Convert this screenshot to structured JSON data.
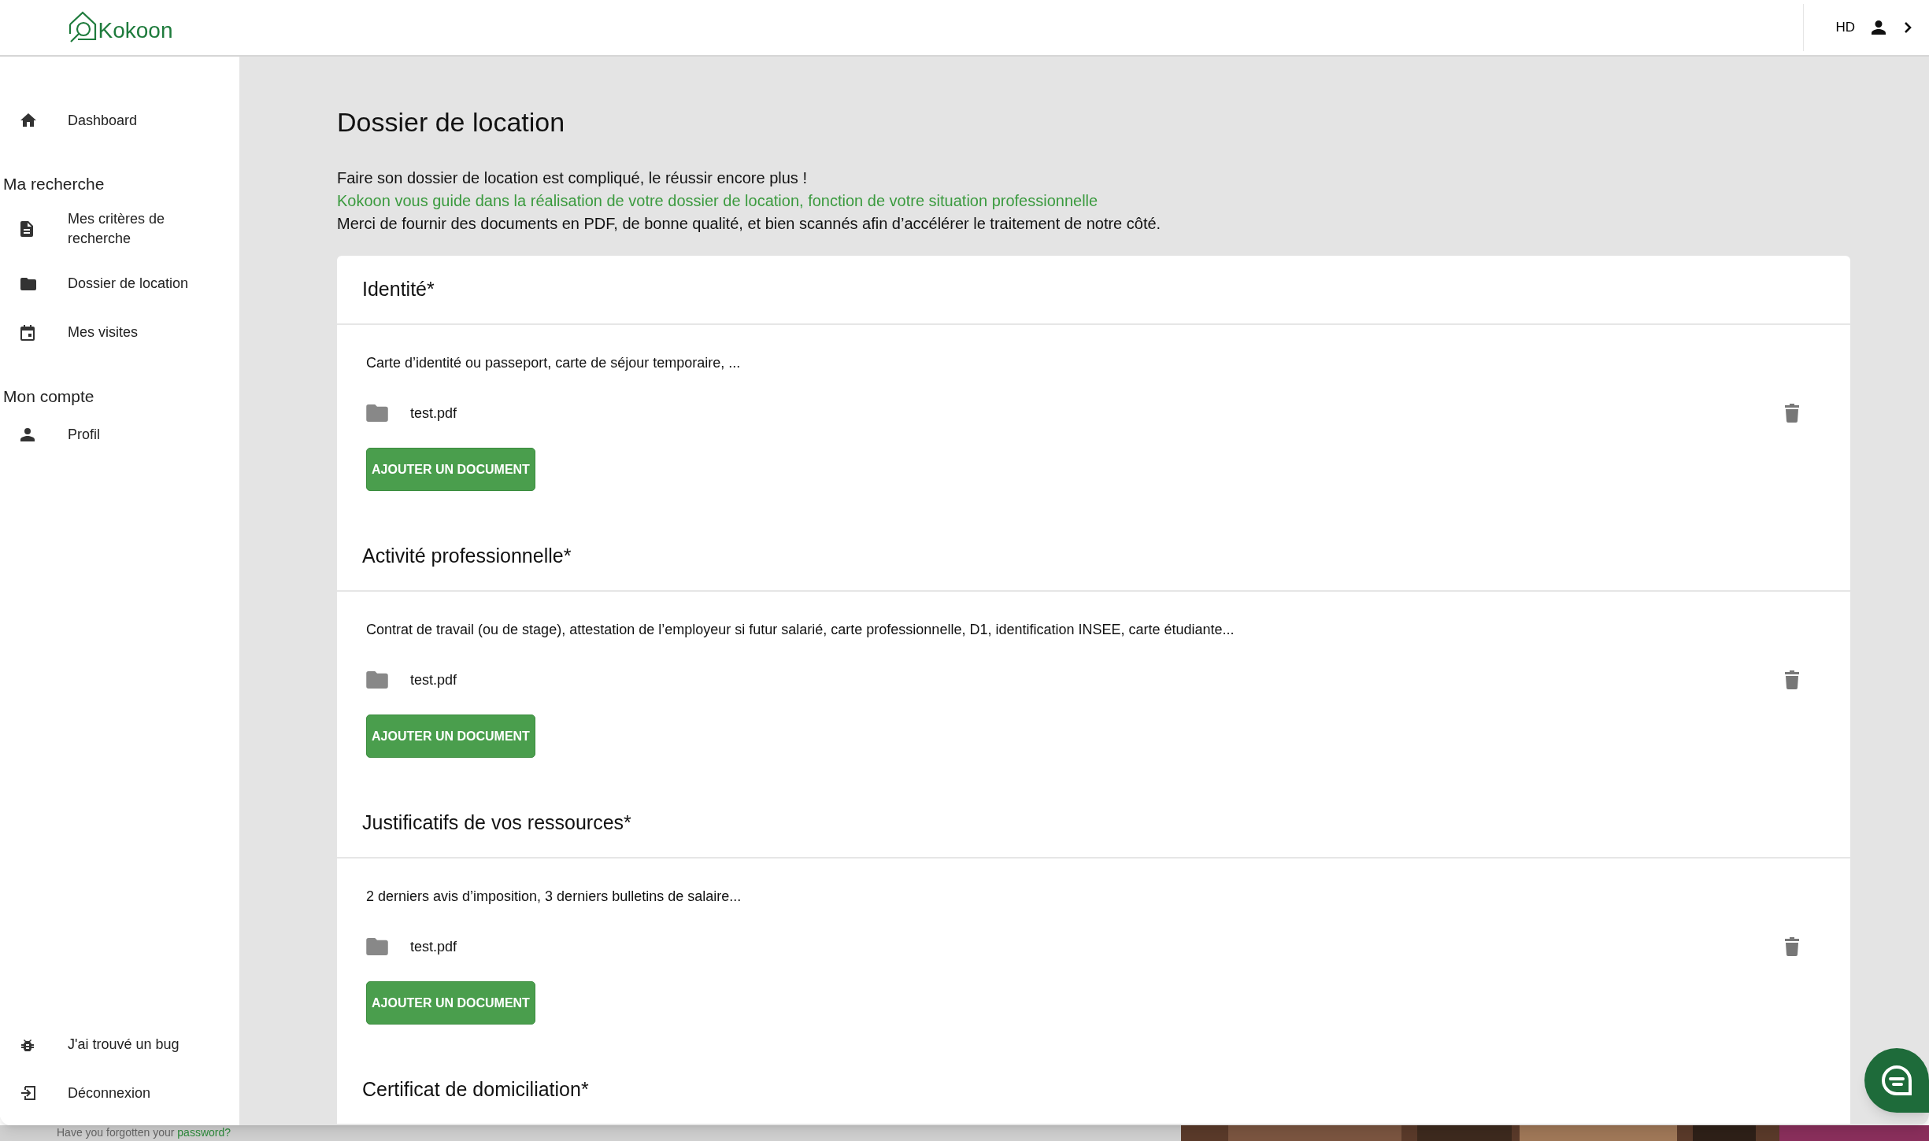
{
  "header": {
    "logo": "Kokoon",
    "user_initials": "HD"
  },
  "sidebar": {
    "top_items": [
      {
        "label": "Dashboard"
      }
    ],
    "sections": [
      {
        "heading": "Ma recherche",
        "items": [
          {
            "label": "Mes critères de recherche"
          },
          {
            "label": "Dossier de location"
          },
          {
            "label": "Mes visites"
          }
        ]
      },
      {
        "heading": "Mon compte",
        "items": [
          {
            "label": "Profil"
          }
        ]
      }
    ],
    "bottom_items": [
      {
        "label": "J'ai trouvé un bug"
      },
      {
        "label": "Déconnexion"
      }
    ]
  },
  "main": {
    "title": "Dossier de location",
    "intro": [
      {
        "text": "Faire son dossier de location est compliqué, le réussir encore plus !",
        "kind": "plain"
      },
      {
        "text": "Kokoon vous guide dans la réalisation de votre dossier de location, fonction de votre situation professionnelle",
        "kind": "accent"
      },
      {
        "text": "Merci de fournir des documents en PDF, de bonne qualité, et bien scannés afin d’accélérer le traitement de notre côté.",
        "kind": "plain"
      }
    ],
    "sections": [
      {
        "heading": "Identité*",
        "description": "Carte d’identité ou passeport, carte de séjour temporaire, ...",
        "files": [
          {
            "name": "test.pdf"
          }
        ],
        "button": "AJOUTER UN DOCUMENT"
      },
      {
        "heading": "Activité professionnelle*",
        "description": "Contrat de travail (ou de stage), attestation de l’employeur si futur salarié, carte professionnelle, D1, identification INSEE, carte étudiante...",
        "files": [
          {
            "name": "test.pdf"
          }
        ],
        "button": "AJOUTER UN DOCUMENT"
      },
      {
        "heading": "Justificatifs de vos ressources*",
        "description": "2 derniers avis d’imposition, 3 derniers bulletins de salaire...",
        "files": [
          {
            "name": "test.pdf"
          }
        ],
        "button": "AJOUTER UN DOCUMENT"
      },
      {
        "heading": "Certificat de domiciliation*"
      }
    ]
  },
  "background_page": {
    "text": "Have you forgotten your ",
    "link": "password?"
  }
}
